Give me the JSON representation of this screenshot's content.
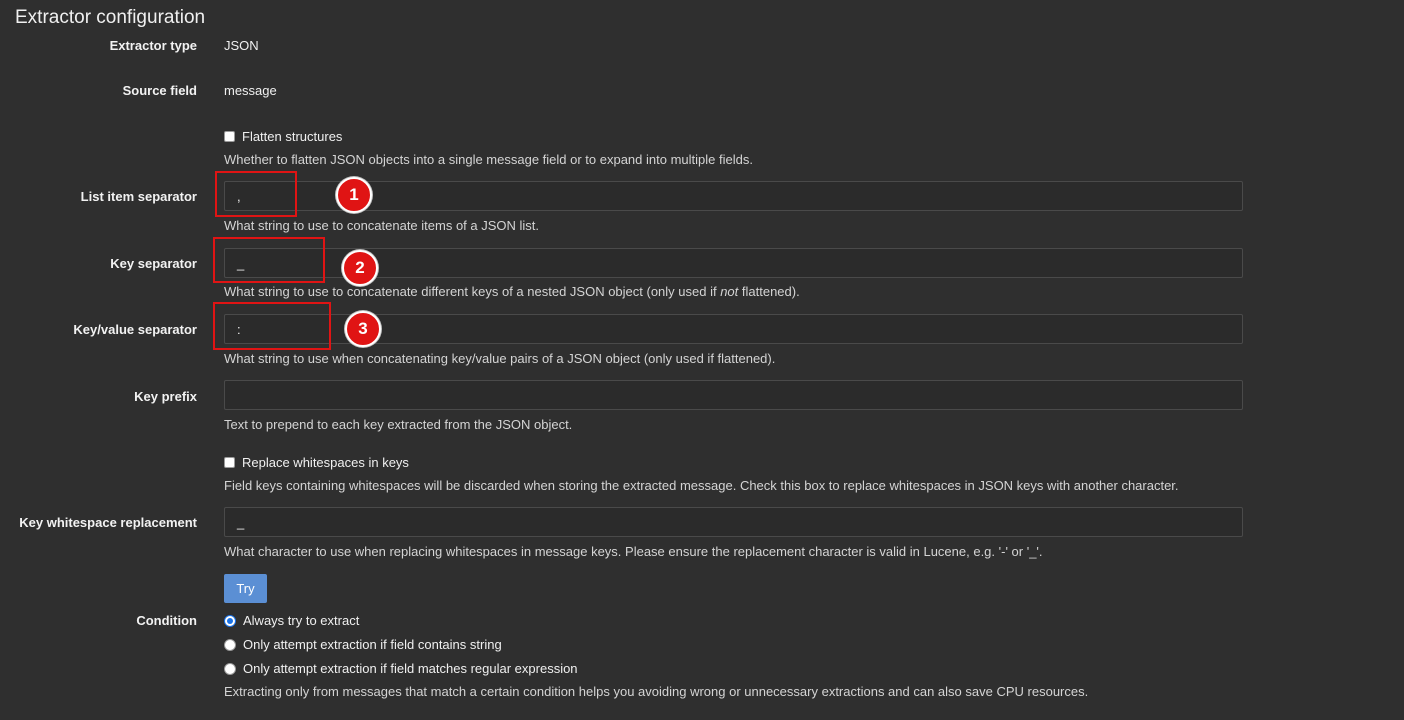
{
  "page": {
    "title": "Extractor configuration"
  },
  "extractor_type": {
    "label": "Extractor type",
    "value": "JSON"
  },
  "source_field": {
    "label": "Source field",
    "value": "message"
  },
  "flatten": {
    "label": "Flatten structures",
    "checked": false,
    "help": "Whether to flatten JSON objects into a single message field or to expand into multiple fields."
  },
  "list_item_separator": {
    "label": "List item separator",
    "value": ",",
    "help": "What string to use to concatenate items of a JSON list."
  },
  "key_separator": {
    "label": "Key separator",
    "value": "_",
    "help_before": "What string to use to concatenate different keys of a nested JSON object (only used if ",
    "help_em": "not",
    "help_after": " flattened)."
  },
  "key_value_separator": {
    "label": "Key/value separator",
    "value": ":",
    "help": "What string to use when concatenating key/value pairs of a JSON object (only used if flattened)."
  },
  "key_prefix": {
    "label": "Key prefix",
    "value": "",
    "help": "Text to prepend to each key extracted from the JSON object."
  },
  "replace_whitespace": {
    "label": "Replace whitespaces in keys",
    "checked": false,
    "help": "Field keys containing whitespaces will be discarded when storing the extracted message. Check this box to replace whitespaces in JSON keys with another character."
  },
  "key_whitespace_replacement": {
    "label": "Key whitespace replacement",
    "value": "_",
    "help": "What character to use when replacing whitespaces in message keys. Please ensure the replacement character is valid in Lucene, e.g. '-' or '_'."
  },
  "try_button": {
    "label": "Try"
  },
  "condition": {
    "label": "Condition",
    "options": [
      {
        "label": "Always try to extract",
        "checked": true
      },
      {
        "label": "Only attempt extraction if field contains string",
        "checked": false
      },
      {
        "label": "Only attempt extraction if field matches regular expression",
        "checked": false
      }
    ],
    "help": "Extracting only from messages that match a certain condition helps you avoiding wrong or unnecessary extractions and can also save CPU resources."
  },
  "annotations": {
    "markers": [
      "1",
      "2",
      "3"
    ],
    "highlight_color": "#e01414"
  }
}
